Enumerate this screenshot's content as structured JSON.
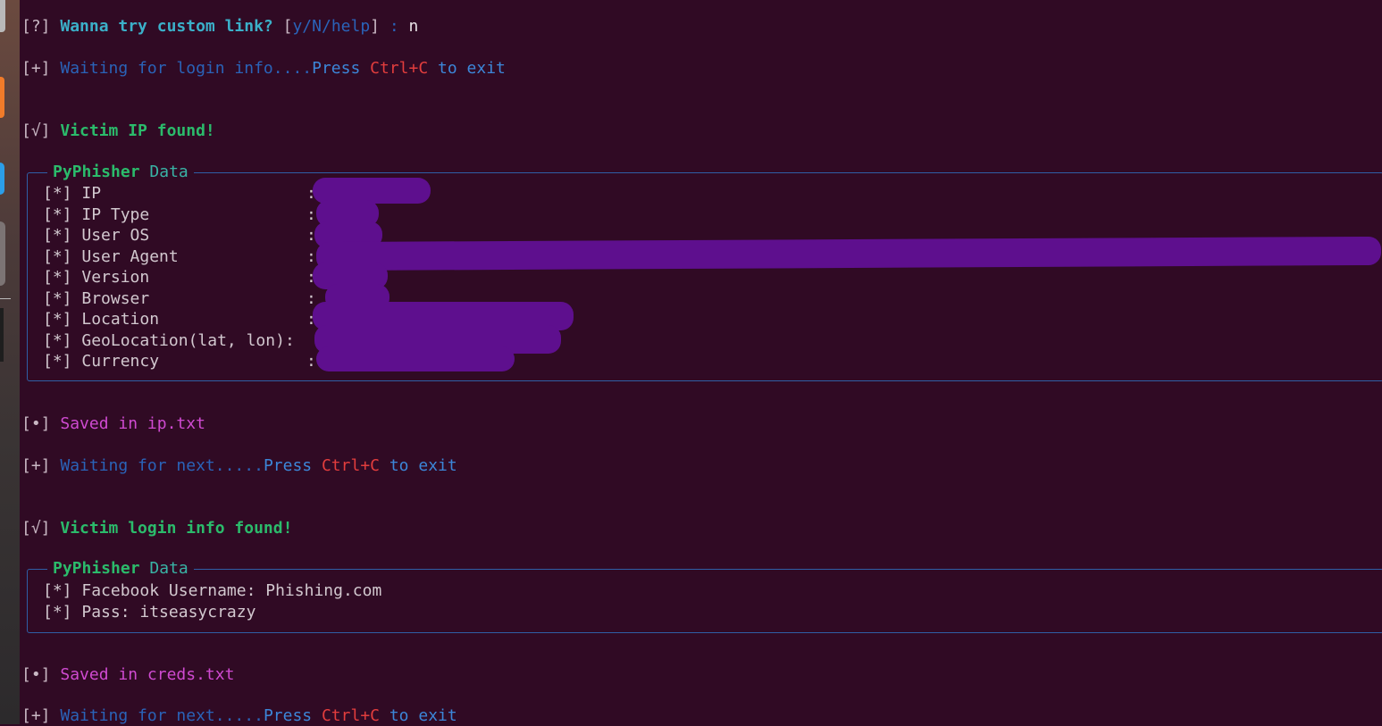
{
  "prompt": {
    "mark": "[?]",
    "question": "Wanna try custom link?",
    "options_open": "[",
    "options": "y/N/help",
    "options_close": "]",
    "colon": " : ",
    "answer": "n"
  },
  "waiting_lines": [
    {
      "mark": "[+]",
      "text": "Waiting for login info....",
      "press": "Press",
      "key": "Ctrl+C",
      "tail": "to exit"
    },
    {
      "mark": "[+]",
      "text": "Waiting for next.....",
      "press": "Press",
      "key": "Ctrl+C",
      "tail": "to exit"
    },
    {
      "mark": "[+]",
      "text": "Waiting for next.....",
      "press": "Press",
      "key": "Ctrl+C",
      "tail": "to exit"
    }
  ],
  "found": [
    {
      "mark": "[√]",
      "text": "Victim IP found!"
    },
    {
      "mark": "[√]",
      "text": "Victim login info found!"
    }
  ],
  "panel_title": {
    "brand": "PyPhisher",
    "word": "Data"
  },
  "ip_panel": {
    "rows": [
      {
        "mark": "[*]",
        "label": "IP",
        "sep": ":"
      },
      {
        "mark": "[*]",
        "label": "IP Type",
        "sep": ":"
      },
      {
        "mark": "[*]",
        "label": "User OS",
        "sep": ":"
      },
      {
        "mark": "[*]",
        "label": "User Agent",
        "sep": ":"
      },
      {
        "mark": "[*]",
        "label": "Version",
        "sep": ":"
      },
      {
        "mark": "[*]",
        "label": "Browser",
        "sep": ":"
      },
      {
        "mark": "[*]",
        "label": "Location",
        "sep": ":"
      },
      {
        "mark": "[*]",
        "label": "GeoLocation(lat, lon)",
        "sep": ":"
      },
      {
        "mark": "[*]",
        "label": "Currency",
        "sep": ":"
      }
    ]
  },
  "creds_panel": {
    "rows": [
      {
        "mark": "[*]",
        "text": "Facebook Username: Phishing.com"
      },
      {
        "mark": "[*]",
        "text": "Pass: itseasycrazy"
      }
    ]
  },
  "saved": [
    {
      "mark": "[•]",
      "text": "Saved in ip.txt"
    },
    {
      "mark": "[•]",
      "text": "Saved in creds.txt"
    }
  ],
  "colors": {
    "background": "#300a24",
    "redaction": "#5e0f8e",
    "panel_border": "#2f5fa6"
  }
}
